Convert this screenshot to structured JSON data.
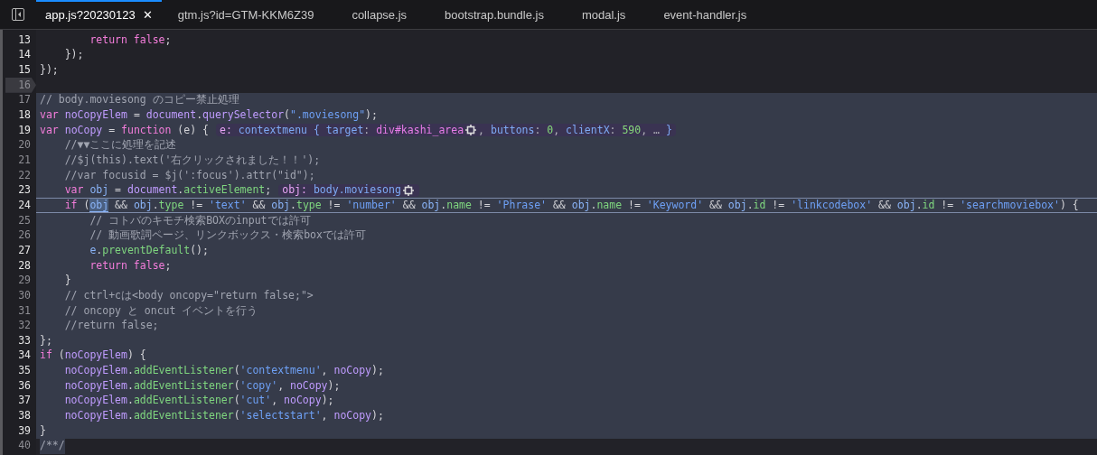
{
  "tabs": [
    {
      "label": "app.js?20230123",
      "selected": true,
      "closable": true
    },
    {
      "label": "gtm.js?id=GTM-KKM6Z39",
      "selected": false,
      "closable": false
    },
    {
      "label": "collapse.js",
      "selected": false,
      "closable": false
    },
    {
      "label": "bootstrap.bundle.js",
      "selected": false,
      "closable": false
    },
    {
      "label": "modal.js",
      "selected": false,
      "closable": false
    },
    {
      "label": "event-handler.js",
      "selected": false,
      "closable": false
    }
  ],
  "close_glyph": "✕",
  "code_lines": [
    {
      "number": "13",
      "executable": true,
      "marked": false,
      "current": false,
      "selected": false,
      "tokens": [
        {
          "kind": "keyword",
          "text": "        return"
        },
        {
          "kind": "keyword",
          "text": " false"
        },
        {
          "kind": "plain",
          "text": ";"
        }
      ]
    },
    {
      "number": "14",
      "executable": true,
      "marked": false,
      "current": false,
      "selected": false,
      "tokens": [
        {
          "kind": "plain",
          "text": "    });"
        }
      ]
    },
    {
      "number": "15",
      "executable": true,
      "marked": false,
      "current": false,
      "selected": false,
      "tokens": [
        {
          "kind": "plain",
          "text": "});"
        }
      ]
    },
    {
      "number": "16",
      "executable": false,
      "marked": true,
      "current": false,
      "selected": false
    },
    {
      "number": "17",
      "executable": false,
      "marked": false,
      "current": false,
      "selected": true,
      "tokens": [
        {
          "kind": "comment",
          "text": "// body.moviesong のコピー禁止処理"
        }
      ]
    },
    {
      "number": "18",
      "executable": true,
      "marked": false,
      "current": false,
      "selected": true,
      "tokens": [
        {
          "kind": "keyword",
          "text": "var"
        },
        {
          "kind": "global",
          "text": " noCopyElem"
        },
        {
          "kind": "plain",
          "text": " = "
        },
        {
          "kind": "global",
          "text": "document"
        },
        {
          "kind": "plain",
          "text": "."
        },
        {
          "kind": "global",
          "text": "querySelector"
        },
        {
          "kind": "plain",
          "text": "("
        },
        {
          "kind": "string",
          "text": "\".moviesong\""
        },
        {
          "kind": "plain",
          "text": ");"
        }
      ]
    },
    {
      "number": "19",
      "executable": true,
      "marked": false,
      "current": false,
      "selected": true,
      "tokens": [
        {
          "kind": "keyword",
          "text": "var"
        },
        {
          "kind": "global",
          "text": " noCopy"
        },
        {
          "kind": "plain",
          "text": " = "
        },
        {
          "kind": "keyword",
          "text": "function"
        },
        {
          "kind": "plain",
          "text": " (e) {"
        }
      ],
      "preview": {
        "label": "e:",
        "parts": [
          {
            "kind": "value",
            "text": "contextmenu { "
          },
          {
            "kind": "value",
            "text": "target"
          },
          {
            "kind": "punct",
            "text": ": "
          },
          {
            "kind": "node",
            "text": "div#kashi_area"
          },
          {
            "kind": "icon"
          },
          {
            "kind": "punct",
            "text": ", "
          },
          {
            "kind": "value",
            "text": "buttons"
          },
          {
            "kind": "punct",
            "text": ": "
          },
          {
            "kind": "number",
            "text": "0"
          },
          {
            "kind": "punct",
            "text": ", "
          },
          {
            "kind": "value",
            "text": "clientX"
          },
          {
            "kind": "punct",
            "text": ": "
          },
          {
            "kind": "number",
            "text": "590"
          },
          {
            "kind": "punct",
            "text": ", … "
          },
          {
            "kind": "value",
            "text": "}"
          }
        ]
      }
    },
    {
      "number": "20",
      "executable": false,
      "marked": false,
      "current": false,
      "selected": true,
      "tokens": [
        {
          "kind": "comment",
          "text": "    //▼▼ここに処理を記述"
        }
      ]
    },
    {
      "number": "21",
      "executable": false,
      "marked": false,
      "current": false,
      "selected": true,
      "tokens": [
        {
          "kind": "comment",
          "text": "    //$j(this).text('右クリックされました！！');"
        }
      ]
    },
    {
      "number": "22",
      "executable": false,
      "marked": false,
      "current": false,
      "selected": true,
      "tokens": [
        {
          "kind": "comment",
          "text": "    //var focusid = $j(':focus').attr(\"id\");"
        }
      ]
    },
    {
      "number": "23",
      "executable": true,
      "marked": false,
      "current": false,
      "selected": true,
      "tokens": [
        {
          "kind": "keyword",
          "text": "    var"
        },
        {
          "kind": "local",
          "text": " obj"
        },
        {
          "kind": "plain",
          "text": " = "
        },
        {
          "kind": "global",
          "text": "document"
        },
        {
          "kind": "plain",
          "text": "."
        },
        {
          "kind": "property",
          "text": "activeElement"
        },
        {
          "kind": "plain",
          "text": ";"
        }
      ],
      "preview": {
        "label": "obj:",
        "parts": [
          {
            "kind": "value",
            "text": "body.moviesong"
          },
          {
            "kind": "icon"
          }
        ]
      }
    },
    {
      "number": "24",
      "executable": true,
      "marked": false,
      "current": true,
      "selected": true,
      "tokens": [
        {
          "kind": "keyword",
          "text": "    if"
        },
        {
          "kind": "plain",
          "text": " ("
        },
        {
          "kind": "match",
          "text": "obj"
        },
        {
          "kind": "plain",
          "text": " && "
        },
        {
          "kind": "local",
          "text": "obj"
        },
        {
          "kind": "plain",
          "text": "."
        },
        {
          "kind": "property",
          "text": "type"
        },
        {
          "kind": "plain",
          "text": " != "
        },
        {
          "kind": "string",
          "text": "'text'"
        },
        {
          "kind": "plain",
          "text": " && "
        },
        {
          "kind": "local",
          "text": "obj"
        },
        {
          "kind": "plain",
          "text": "."
        },
        {
          "kind": "property",
          "text": "type"
        },
        {
          "kind": "plain",
          "text": " != "
        },
        {
          "kind": "string",
          "text": "'number'"
        },
        {
          "kind": "plain",
          "text": " && "
        },
        {
          "kind": "local",
          "text": "obj"
        },
        {
          "kind": "plain",
          "text": "."
        },
        {
          "kind": "property",
          "text": "name"
        },
        {
          "kind": "plain",
          "text": " != "
        },
        {
          "kind": "string",
          "text": "'Phrase'"
        },
        {
          "kind": "plain",
          "text": " && "
        },
        {
          "kind": "local",
          "text": "obj"
        },
        {
          "kind": "plain",
          "text": "."
        },
        {
          "kind": "property",
          "text": "name"
        },
        {
          "kind": "plain",
          "text": " != "
        },
        {
          "kind": "string",
          "text": "'Keyword'"
        },
        {
          "kind": "plain",
          "text": " && "
        },
        {
          "kind": "local",
          "text": "obj"
        },
        {
          "kind": "plain",
          "text": "."
        },
        {
          "kind": "property",
          "text": "id"
        },
        {
          "kind": "plain",
          "text": " != "
        },
        {
          "kind": "string",
          "text": "'linkcodebox'"
        },
        {
          "kind": "plain",
          "text": " && "
        },
        {
          "kind": "local",
          "text": "obj"
        },
        {
          "kind": "plain",
          "text": "."
        },
        {
          "kind": "property",
          "text": "id"
        },
        {
          "kind": "plain",
          "text": " != "
        },
        {
          "kind": "string",
          "text": "'searchmoviebox'"
        },
        {
          "kind": "plain",
          "text": ") {"
        }
      ]
    },
    {
      "number": "25",
      "executable": false,
      "marked": false,
      "current": false,
      "selected": true,
      "tokens": [
        {
          "kind": "comment",
          "text": "        // コトバのキモチ検索BOXのinputでは許可"
        }
      ]
    },
    {
      "number": "26",
      "executable": false,
      "marked": false,
      "current": false,
      "selected": true,
      "tokens": [
        {
          "kind": "comment",
          "text": "        // 動画歌詞ページ、リンクボックス・検索boxでは許可"
        }
      ]
    },
    {
      "number": "27",
      "executable": true,
      "marked": false,
      "current": false,
      "selected": true,
      "tokens": [
        {
          "kind": "local",
          "text": "        e"
        },
        {
          "kind": "plain",
          "text": "."
        },
        {
          "kind": "property",
          "text": "preventDefault"
        },
        {
          "kind": "plain",
          "text": "();"
        }
      ]
    },
    {
      "number": "28",
      "executable": true,
      "marked": false,
      "current": false,
      "selected": true,
      "tokens": [
        {
          "kind": "keyword",
          "text": "        return"
        },
        {
          "kind": "keyword",
          "text": " false"
        },
        {
          "kind": "plain",
          "text": ";"
        }
      ]
    },
    {
      "number": "29",
      "executable": false,
      "marked": false,
      "current": false,
      "selected": true,
      "tokens": [
        {
          "kind": "plain",
          "text": "    }"
        }
      ]
    },
    {
      "number": "30",
      "executable": false,
      "marked": false,
      "current": false,
      "selected": true,
      "tokens": [
        {
          "kind": "comment",
          "text": "    // ctrl+cは<body oncopy=\"return false;\">"
        }
      ]
    },
    {
      "number": "31",
      "executable": false,
      "marked": false,
      "current": false,
      "selected": true,
      "tokens": [
        {
          "kind": "comment",
          "text": "    // oncopy と oncut イベントを行う"
        }
      ]
    },
    {
      "number": "32",
      "executable": false,
      "marked": false,
      "current": false,
      "selected": true,
      "tokens": [
        {
          "kind": "comment",
          "text": "    //return false;"
        }
      ]
    },
    {
      "number": "33",
      "executable": true,
      "marked": false,
      "current": false,
      "selected": true,
      "tokens": [
        {
          "kind": "plain",
          "text": "};"
        }
      ]
    },
    {
      "number": "34",
      "executable": true,
      "marked": false,
      "current": false,
      "selected": true,
      "tokens": [
        {
          "kind": "keyword",
          "text": "if"
        },
        {
          "kind": "plain",
          "text": " ("
        },
        {
          "kind": "global",
          "text": "noCopyElem"
        },
        {
          "kind": "plain",
          "text": ") {"
        }
      ]
    },
    {
      "number": "35",
      "executable": true,
      "marked": false,
      "current": false,
      "selected": true,
      "tokens": [
        {
          "kind": "global",
          "text": "    noCopyElem"
        },
        {
          "kind": "plain",
          "text": "."
        },
        {
          "kind": "property",
          "text": "addEventListener"
        },
        {
          "kind": "plain",
          "text": "("
        },
        {
          "kind": "string",
          "text": "'contextmenu'"
        },
        {
          "kind": "plain",
          "text": ", "
        },
        {
          "kind": "global",
          "text": "noCopy"
        },
        {
          "kind": "plain",
          "text": ");"
        }
      ]
    },
    {
      "number": "36",
      "executable": true,
      "marked": false,
      "current": false,
      "selected": true,
      "tokens": [
        {
          "kind": "global",
          "text": "    noCopyElem"
        },
        {
          "kind": "plain",
          "text": "."
        },
        {
          "kind": "property",
          "text": "addEventListener"
        },
        {
          "kind": "plain",
          "text": "("
        },
        {
          "kind": "string",
          "text": "'copy'"
        },
        {
          "kind": "plain",
          "text": ", "
        },
        {
          "kind": "global",
          "text": "noCopy"
        },
        {
          "kind": "plain",
          "text": ");"
        }
      ]
    },
    {
      "number": "37",
      "executable": true,
      "marked": false,
      "current": false,
      "selected": true,
      "tokens": [
        {
          "kind": "global",
          "text": "    noCopyElem"
        },
        {
          "kind": "plain",
          "text": "."
        },
        {
          "kind": "property",
          "text": "addEventListener"
        },
        {
          "kind": "plain",
          "text": "("
        },
        {
          "kind": "string",
          "text": "'cut'"
        },
        {
          "kind": "plain",
          "text": ", "
        },
        {
          "kind": "global",
          "text": "noCopy"
        },
        {
          "kind": "plain",
          "text": ");"
        }
      ]
    },
    {
      "number": "38",
      "executable": true,
      "marked": false,
      "current": false,
      "selected": true,
      "tokens": [
        {
          "kind": "global",
          "text": "    noCopyElem"
        },
        {
          "kind": "plain",
          "text": "."
        },
        {
          "kind": "property",
          "text": "addEventListener"
        },
        {
          "kind": "plain",
          "text": "("
        },
        {
          "kind": "string",
          "text": "'selectstart'"
        },
        {
          "kind": "plain",
          "text": ", "
        },
        {
          "kind": "global",
          "text": "noCopy"
        },
        {
          "kind": "plain",
          "text": ");"
        }
      ]
    },
    {
      "number": "39",
      "executable": true,
      "marked": false,
      "current": false,
      "selected": true,
      "tokens": [
        {
          "kind": "plain",
          "text": "}"
        }
      ]
    },
    {
      "number": "40",
      "executable": false,
      "marked": false,
      "current": false,
      "selected": false,
      "text_selected": true,
      "tokens": [
        {
          "kind": "comment",
          "text": "/**/"
        }
      ]
    }
  ]
}
